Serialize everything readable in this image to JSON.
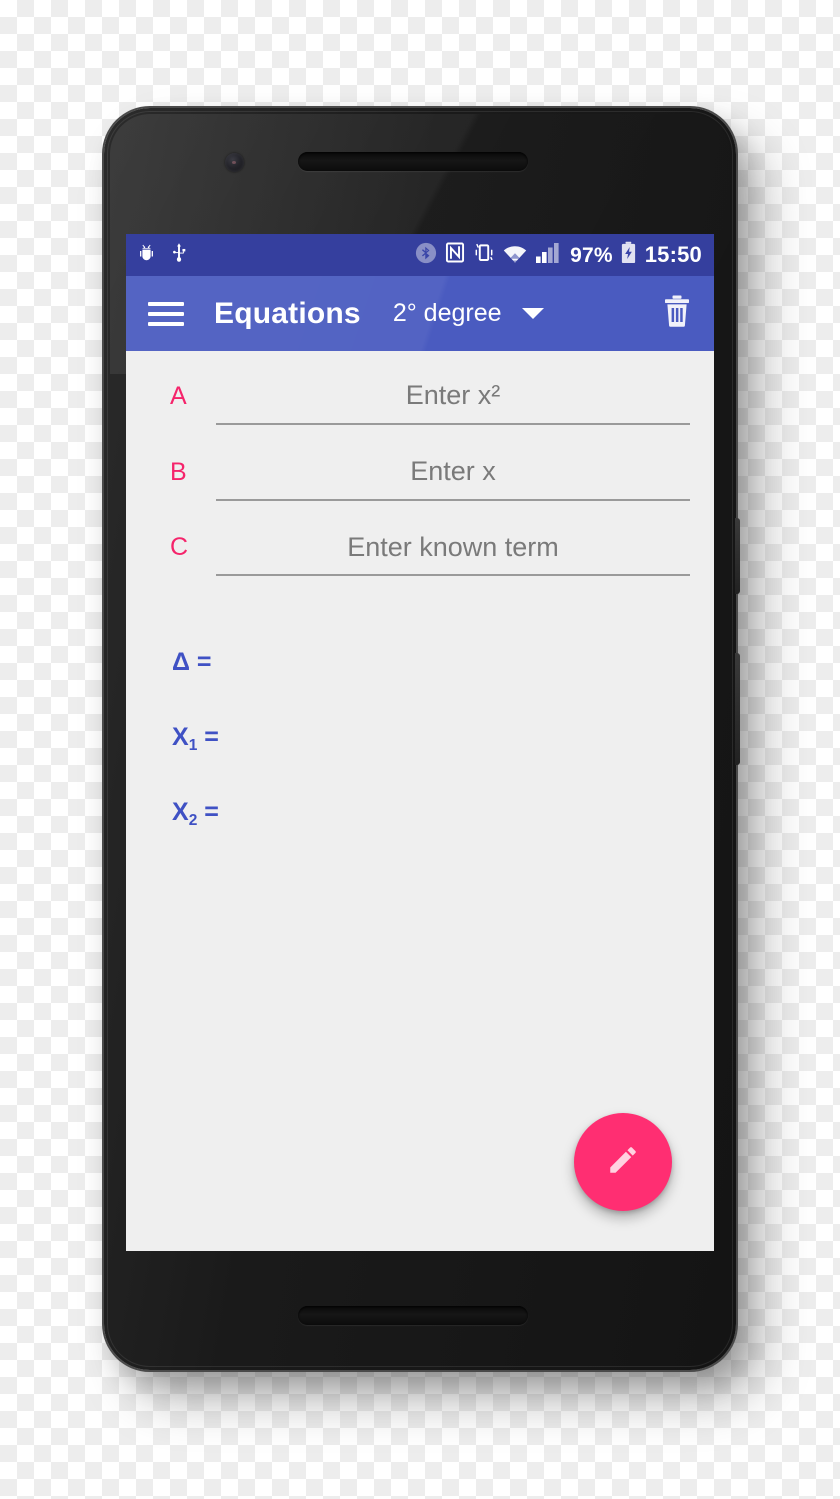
{
  "status_bar": {
    "left_icons": [
      "android-debug-bug-icon",
      "usb-icon"
    ],
    "right_icons": [
      "bluetooth-icon",
      "nfc-icon",
      "vibrate-mode-icon",
      "wifi-icon",
      "cellular-signal-icon"
    ],
    "battery_percent": "97%",
    "battery_icon": "battery-charging-icon",
    "clock": "15:50",
    "background_color": "#353F9E"
  },
  "app_bar": {
    "menu_icon": "hamburger-menu-icon",
    "title": "Equations",
    "spinner_value": "2° degree",
    "spinner_caret_icon": "chevron-down-icon",
    "delete_icon": "trash-icon",
    "background_color": "#4A5BC0"
  },
  "form": {
    "label_color": "#F5246B",
    "fields": [
      {
        "letter": "A",
        "placeholder": "Enter x²",
        "value": ""
      },
      {
        "letter": "B",
        "placeholder": "Enter x",
        "value": ""
      },
      {
        "letter": "C",
        "placeholder": "Enter known term",
        "value": ""
      }
    ]
  },
  "results": {
    "color": "#3F51C4",
    "rows": [
      {
        "label": "Δ",
        "sub": "",
        "equals": "=",
        "value": ""
      },
      {
        "label": "X",
        "sub": "1",
        "equals": "=",
        "value": ""
      },
      {
        "label": "X",
        "sub": "2",
        "equals": "=",
        "value": ""
      }
    ]
  },
  "fab": {
    "icon": "pencil-edit-icon",
    "color": "#FF2E72"
  },
  "screen": {
    "background_color": "#EFEFEF"
  }
}
